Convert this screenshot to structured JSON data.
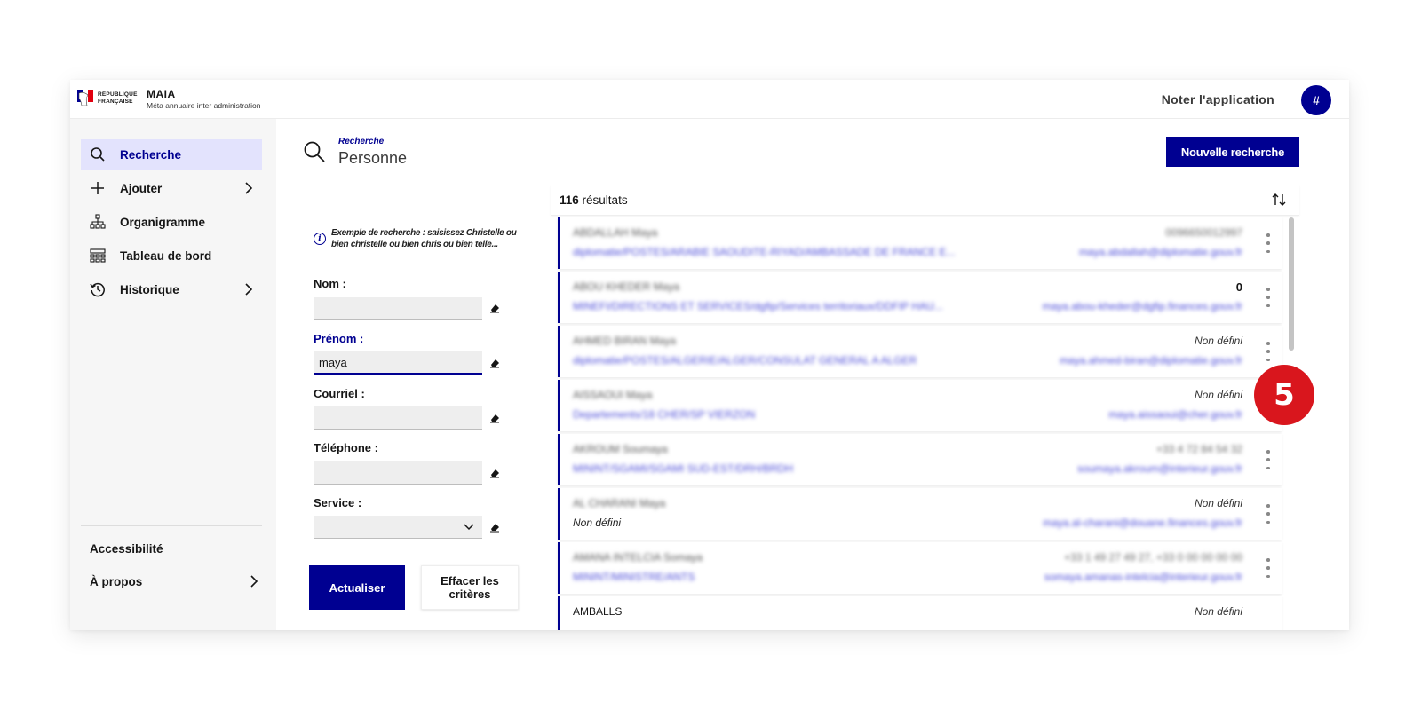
{
  "header": {
    "logo_text": "RÉPUBLIQUE FRANÇAISE",
    "app_name": "MAIA",
    "app_subtitle": "Méta annuaire inter administration",
    "rate_link": "Noter l'application",
    "avatar_initial": "#"
  },
  "sidebar": {
    "items": [
      {
        "label": "Recherche",
        "icon": "search-icon",
        "active": true
      },
      {
        "label": "Ajouter",
        "icon": "plus-icon",
        "has_submenu": true
      },
      {
        "label": "Organigramme",
        "icon": "org-chart-icon"
      },
      {
        "label": "Tableau de bord",
        "icon": "dashboard-icon"
      },
      {
        "label": "Historique",
        "icon": "history-icon",
        "has_submenu": true
      }
    ],
    "footer": [
      {
        "label": "Accessibilité"
      },
      {
        "label": "À propos",
        "has_submenu": true
      }
    ]
  },
  "search": {
    "breadcrumb": "Recherche",
    "title": "Personne",
    "new_search_button": "Nouvelle recherche",
    "hint": "Exemple de recherche : saisissez Christelle ou bien christelle ou bien chris ou bien telle...",
    "fields": {
      "nom": {
        "label": "Nom :",
        "value": ""
      },
      "prenom": {
        "label": "Prénom :",
        "value": "maya"
      },
      "courriel": {
        "label": "Courriel :",
        "value": ""
      },
      "telephone": {
        "label": "Téléphone :",
        "value": ""
      },
      "service": {
        "label": "Service :",
        "value": ""
      }
    },
    "refresh_button": "Actualiser",
    "clear_button": "Effacer les critères"
  },
  "results": {
    "count": "116",
    "count_label": "résultats",
    "rows": [
      {
        "name": "ABDALLAH Maya",
        "service": "diplomatie/POSTES/ARABIE SAOUDITE-RIYAD/AMBASSADE DE FRANCE E...",
        "phone": "0096650012997",
        "email": "maya.abdallah@diplomatie.gouv.fr"
      },
      {
        "name": "ABOU KHEDER Maya",
        "service": "MINEFI/DIRECTIONS ET SERVICES/dgfip/Services territoriaux/DDFIP HAU...",
        "phone": "0",
        "email": "maya.abou-kheder@dgfip.finances.gouv.fr"
      },
      {
        "name": "AHMED BIRAN Maya",
        "service": "diplomatie/POSTES/ALGERIE/ALGER/CONSULAT GENERAL A ALGER",
        "phone": "Non défini",
        "email": "maya.ahmed-biran@diplomatie.gouv.fr"
      },
      {
        "name": "AISSAOUI Maya",
        "service": "Departements/18 CHER/SP VIERZON",
        "phone": "Non défini",
        "email": "maya.aissaoui@cher.gouv.fr"
      },
      {
        "name": "AKROUM Soumaya",
        "service": "MININT/SGAMI/SGAMI SUD-EST/DRH/BRDH",
        "phone": "+33 4 72 84 54 32",
        "email": "soumaya.akroum@interieur.gouv.fr"
      },
      {
        "name": "AL CHARANI Maya",
        "service": "Non défini",
        "phone": "Non défini",
        "email": "maya.al-charani@douane.finances.gouv.fr"
      },
      {
        "name": "AMANA INTELCIA Somaya",
        "service": "MININT/MINISTRE/ANTS",
        "phone": "+33 1 49 27 49 27, +33 0 00 00 00 00",
        "email": "somaya.amanas-intelcia@interieur.gouv.fr"
      },
      {
        "name": "AMBALLS",
        "service": "",
        "phone": "Non défini",
        "email": ""
      }
    ]
  },
  "callout": {
    "number": "5"
  },
  "colors": {
    "primary": "#000091",
    "active_bg": "#e3e3fd",
    "callout": "#d9161d"
  }
}
